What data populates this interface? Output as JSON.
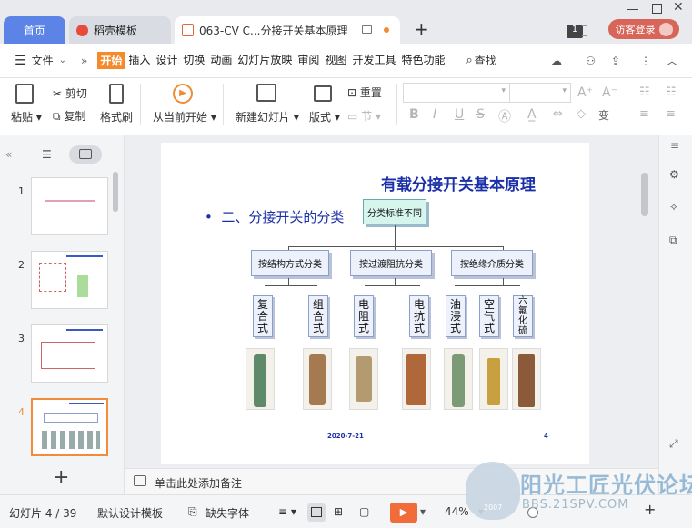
{
  "tabs": {
    "home": "首页",
    "daoke": "稻壳模板",
    "doc": "063-CV C...分接开关基本原理"
  },
  "titlebar": {
    "page_badge": "1",
    "login": "访客登录"
  },
  "menu": {
    "file": "文件",
    "items": [
      "开始",
      "插入",
      "设计",
      "切换",
      "动画",
      "幻灯片放映",
      "审阅",
      "视图",
      "开发工具",
      "特色功能"
    ],
    "search": "查找"
  },
  "ribbon": {
    "paste": "粘贴",
    "cut": "剪切",
    "copy": "复制",
    "format_painter": "格式刷",
    "from_current": "从当前开始",
    "new_slide": "新建幻灯片",
    "layout": "版式",
    "reset": "重置",
    "section": "节",
    "font_bold": "B",
    "font_italic": "I",
    "font_underline": "U",
    "font_strike": "S",
    "font_grow": "A",
    "font_shrink": "A"
  },
  "thumbnails": [
    {
      "num": "1",
      "selected": false
    },
    {
      "num": "2",
      "selected": false
    },
    {
      "num": "3",
      "selected": false
    },
    {
      "num": "4",
      "selected": true
    }
  ],
  "slide": {
    "title": "有载分接开关基本原理",
    "bullet": "二、分接开关的分类",
    "root": "分类标准不同",
    "level2": [
      "按结构方式分类",
      "按过渡阻抗分类",
      "按绝缘介质分类"
    ],
    "level3": [
      [
        "复",
        "合",
        "式"
      ],
      [
        "组",
        "合",
        "式"
      ],
      [
        "电",
        "阻",
        "式"
      ],
      [
        "电",
        "抗",
        "式"
      ],
      [
        "油",
        "浸",
        "式"
      ],
      [
        "空",
        "气",
        "式"
      ],
      [
        "六",
        "氟",
        "化",
        "硫"
      ]
    ],
    "date": "2020-7-21",
    "page": "4"
  },
  "notes": {
    "placeholder": "单击此处添加备注"
  },
  "status": {
    "slide_info": "幻灯片 4 / 39",
    "template": "默认设计模板",
    "missing_font": "缺失字体",
    "zoom": "44%"
  },
  "watermark": {
    "brand": "阳光工匠光伏论坛",
    "url": "BBS.21SPV.COM",
    "year": "2007"
  },
  "colors": {
    "accent": "#f48a2c",
    "title_blue": "#1a2fa8",
    "home_tab": "#5b84e6",
    "login": "#d7655a",
    "play": "#f26b3a"
  }
}
